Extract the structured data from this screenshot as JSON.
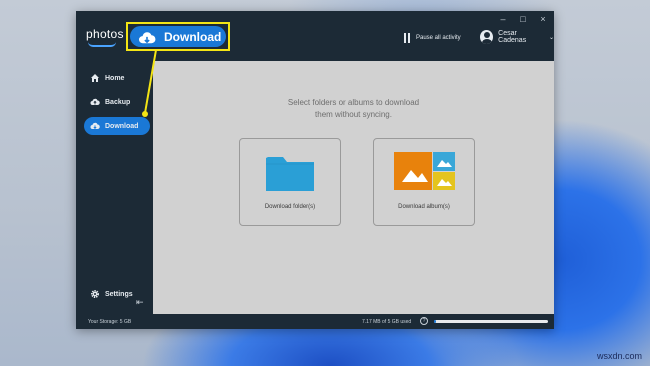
{
  "app": {
    "logo_text": "photos"
  },
  "window_controls": {
    "minimize": "–",
    "maximize": "□",
    "close": "×"
  },
  "header": {
    "pause_label": "Pause all activity",
    "user_name": "Cesar Cadenas",
    "user_caret": "⌄"
  },
  "sidebar": {
    "items": [
      {
        "label": "Home",
        "icon": "home-icon"
      },
      {
        "label": "Backup",
        "icon": "cloud-upload-icon"
      },
      {
        "label": "Download",
        "icon": "cloud-download-icon",
        "active": true
      }
    ],
    "settings_label": "Settings",
    "collapse_glyph": "⇤"
  },
  "main": {
    "prompt_line1": "Select folders or albums to download",
    "prompt_line2": "them without syncing.",
    "cards": [
      {
        "label": "Download folder(s)",
        "icon": "folder-icon"
      },
      {
        "label": "Download album(s)",
        "icon": "album-icon"
      }
    ]
  },
  "status": {
    "storage": "Your Storage: 5 GB",
    "used": "7.17 MB of 5 GB used",
    "help_glyph": "?",
    "usage_fraction": 0.0014
  },
  "callout": {
    "label": "Download",
    "icon": "cloud-download-icon"
  },
  "watermark": "wsxdn.com",
  "colors": {
    "app_dark": "#1c2a36",
    "accent_blue": "#1a78d6",
    "highlight_yellow": "#f4e515",
    "folder_blue": "#2a9fd6",
    "album_orange": "#e8820c",
    "album_blue": "#3aa7d8",
    "album_yellow": "#e4c41e"
  }
}
